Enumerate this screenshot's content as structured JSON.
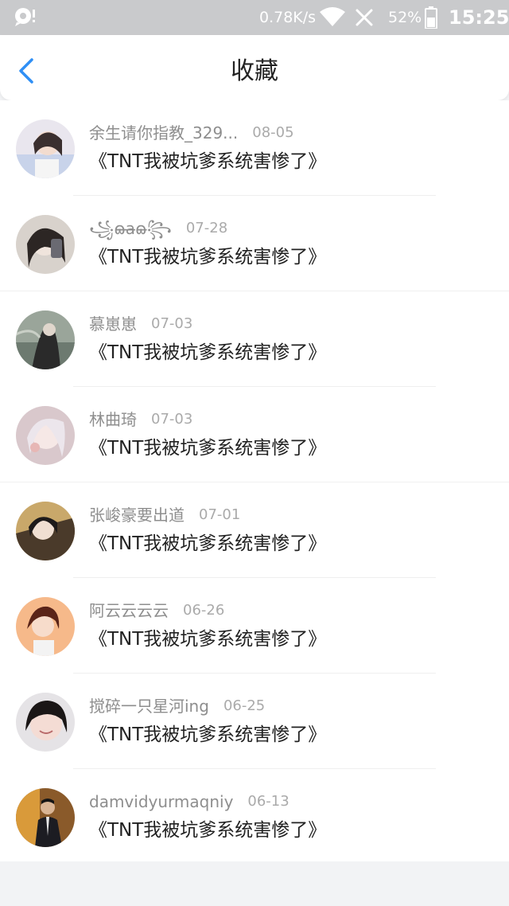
{
  "status_bar": {
    "network_speed": "0.78K/s",
    "battery_percent": "52%",
    "time": "15:25"
  },
  "header": {
    "title": "收藏"
  },
  "items": [
    {
      "username": "余生请你指教_329...",
      "date": "08-05",
      "post_title": "《TNT我被坑爹系统害惨了》"
    },
    {
      "username": "꧁ɷ̶̶̶a̶ɷ̶꧂",
      "date": "07-28",
      "post_title": "《TNT我被坑爹系统害惨了》"
    },
    {
      "username": "慕崽崽",
      "date": "07-03",
      "post_title": "《TNT我被坑爹系统害惨了》"
    },
    {
      "username": "林曲琦",
      "date": "07-03",
      "post_title": "《TNT我被坑爹系统害惨了》"
    },
    {
      "username": "张峻豪要出道",
      "date": "07-01",
      "post_title": "《TNT我被坑爹系统害惨了》"
    },
    {
      "username": "阿云云云云",
      "date": "06-26",
      "post_title": "《TNT我被坑爹系统害惨了》"
    },
    {
      "username": "搅碎一只星河ing",
      "date": "06-25",
      "post_title": "《TNT我被坑爹系统害惨了》"
    },
    {
      "username": "damvidyurmaqniy",
      "date": "06-13",
      "post_title": "《TNT我被坑爹系统害惨了》"
    }
  ],
  "colors": {
    "accent": "#2f8ff5",
    "status_bar_bg": "#c9cacc",
    "page_bg": "#f2f3f5"
  }
}
